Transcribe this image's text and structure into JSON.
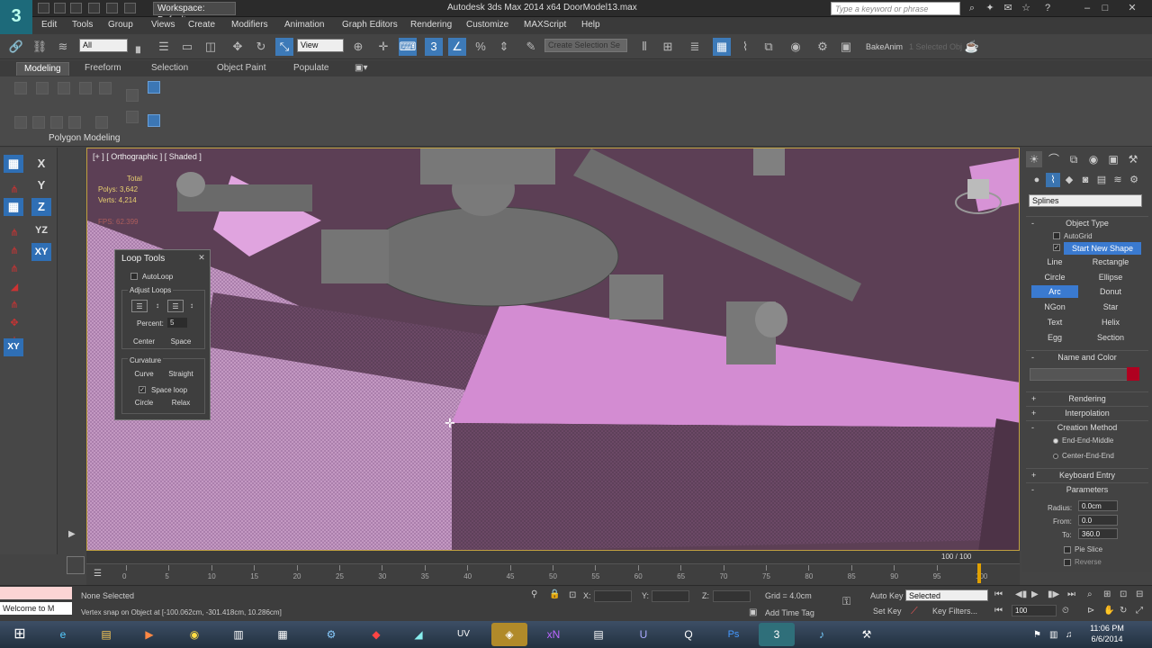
{
  "titlebar": {
    "logo": "3",
    "workspace": "Workspace: Default",
    "app_title": "Autodesk 3ds Max  2014 x64",
    "file_name": "DoorModel13.max",
    "search_placeholder": "Type a keyword or phrase"
  },
  "menu": [
    "Edit",
    "Tools",
    "Group",
    "Views",
    "Create",
    "Modifiers",
    "Animation",
    "Graph Editors",
    "Rendering",
    "Customize",
    "MAXScript",
    "Help"
  ],
  "toolbar": {
    "filter_value": "All",
    "ref_coord_value": "View",
    "named_selection_placeholder": "Create Selection Se",
    "bakeanim": "BakeAnim",
    "selected_obj": "1 Selected Obj"
  },
  "ribbon": {
    "tabs": [
      "Modeling",
      "Freeform",
      "Selection",
      "Object Paint",
      "Populate"
    ],
    "panel_label": "Polygon Modeling"
  },
  "left_bar": {
    "buttons": [
      "X",
      "Y",
      "Z",
      "YZ",
      "XY"
    ]
  },
  "viewport": {
    "label": "[+ ] [ Orthographic ] [ Shaded ]",
    "stats_total": "Total",
    "stats_polys": "Polys:   3,642",
    "stats_verts": "Verts:   4,214",
    "stats_fps": "FPS:    62.399"
  },
  "loop_tools": {
    "title": "Loop Tools",
    "autoloop": "AutoLoop",
    "adjust_loops": "Adjust Loops",
    "percent_label": "Percent:",
    "percent_value": "5",
    "center": "Center",
    "space": "Space",
    "curvature": "Curvature",
    "curve": "Curve",
    "straight": "Straight",
    "space_loop": "Space loop",
    "circle": "Circle",
    "relax": "Relax"
  },
  "command_panel": {
    "category": "Splines",
    "object_type": "Object Type",
    "autogrid": "AutoGrid",
    "start_new_shape": "Start New Shape",
    "shapes": [
      "Line",
      "Rectangle",
      "Circle",
      "Ellipse",
      "Arc",
      "Donut",
      "NGon",
      "Star",
      "Text",
      "Helix",
      "Egg",
      "Section"
    ],
    "name_and_color": "Name and Color",
    "rendering": "Rendering",
    "interpolation": "Interpolation",
    "creation_method": "Creation Method",
    "end_end_middle": "End-End-Middle",
    "center_end_end": "Center-End-End",
    "keyboard_entry": "Keyboard Entry",
    "parameters": "Parameters",
    "radius_label": "Radius:",
    "radius_value": "0.0cm",
    "from_label": "From:",
    "from_value": "0.0",
    "to_label": "To:",
    "to_value": "360.0",
    "pie_slice": "Pie Slice",
    "reverse": "Reverse",
    "color_swatch": "#b00020"
  },
  "timeline": {
    "slider_label": "100 / 100",
    "ticks": [
      "0",
      "5",
      "10",
      "15",
      "20",
      "25",
      "30",
      "35",
      "40",
      "45",
      "50",
      "55",
      "60",
      "65",
      "70",
      "75",
      "80",
      "85",
      "90",
      "95",
      "100"
    ]
  },
  "status": {
    "maxscript_text": "Welcome to M",
    "selection_status": "None Selected",
    "prompt": "Vertex snap on Object at [-100.062cm, -301.418cm, 10.286cm]",
    "x_label": "X:",
    "y_label": "Y:",
    "z_label": "Z:",
    "grid": "Grid = 4.0cm",
    "add_time_tag": "Add Time Tag",
    "auto_key": "Auto Key",
    "set_key": "Set Key",
    "selected_drop": "Selected",
    "key_filters": "Key Filters...",
    "frame_value": "100"
  },
  "taskbar": {
    "clock_time": "11:06 PM",
    "clock_date": "6/6/2014"
  }
}
